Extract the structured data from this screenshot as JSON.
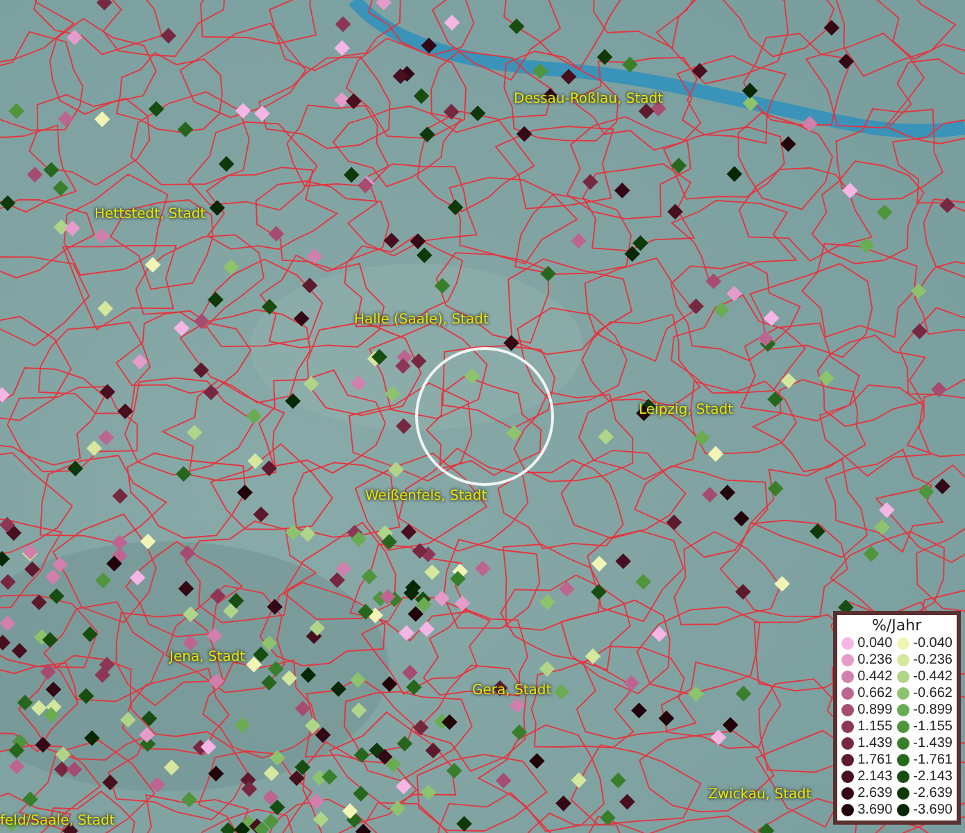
{
  "map": {
    "places": [
      {
        "name": "Dessau-Roßlau, Stadt"
      },
      {
        "name": "Hettstedt, Stadt"
      },
      {
        "name": "Halle (Saale), Stadt"
      },
      {
        "name": "Leipzig, Stadt"
      },
      {
        "name": "Weißenfels, Stadt"
      },
      {
        "name": "Jena, Stadt"
      },
      {
        "name": "Gera, Stadt"
      },
      {
        "name": "Zwickau, Stadt"
      },
      {
        "name": "feld/Saale, Stadt"
      }
    ]
  },
  "legend": {
    "title": "%/Jahr",
    "positive": [
      {
        "value": "0.040",
        "color": "#f5b6e6"
      },
      {
        "value": "0.236",
        "color": "#e69bcb"
      },
      {
        "value": "0.442",
        "color": "#d27fae"
      },
      {
        "value": "0.662",
        "color": "#bd6590"
      },
      {
        "value": "0.899",
        "color": "#a64c70"
      },
      {
        "value": "1.155",
        "color": "#8d3656"
      },
      {
        "value": "1.439",
        "color": "#772841"
      },
      {
        "value": "1.761",
        "color": "#5e1a2d"
      },
      {
        "value": "2.143",
        "color": "#480f1e"
      },
      {
        "value": "2.639",
        "color": "#340814"
      },
      {
        "value": "3.690",
        "color": "#210309"
      }
    ],
    "negative": [
      {
        "value": "-0.040",
        "color": "#f1f4b4"
      },
      {
        "value": "-0.236",
        "color": "#d4e79d"
      },
      {
        "value": "-0.442",
        "color": "#b0d589"
      },
      {
        "value": "-0.662",
        "color": "#8ec36d"
      },
      {
        "value": "-0.899",
        "color": "#69ac51"
      },
      {
        "value": "-1.155",
        "color": "#4e953b"
      },
      {
        "value": "-1.439",
        "color": "#397f2b"
      },
      {
        "value": "-1.761",
        "color": "#27671d"
      },
      {
        "value": "-2.143",
        "color": "#184d12"
      },
      {
        "value": "-2.639",
        "color": "#0e390a"
      },
      {
        "value": "-3.690",
        "color": "#072705"
      }
    ]
  }
}
